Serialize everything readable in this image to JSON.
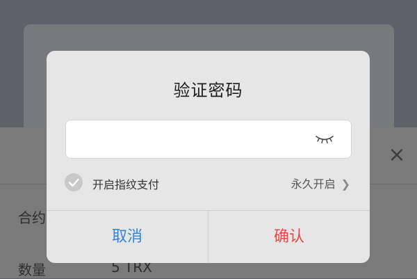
{
  "background": {
    "close_symbol": "×",
    "rows": [
      {
        "label": "合约",
        "value": ""
      },
      {
        "label": "数量",
        "value": "5 TRX"
      }
    ]
  },
  "dialog": {
    "title": "验证密码",
    "password_value": "",
    "eye_icon": "eye-closed-icon",
    "fingerprint_label": "开启指纹支付",
    "fingerprint_checked": true,
    "forever_label": "永久开启",
    "cancel_label": "取消",
    "confirm_label": "确认",
    "cancel_color": "#2f86d8",
    "confirm_color": "#e24b44"
  }
}
